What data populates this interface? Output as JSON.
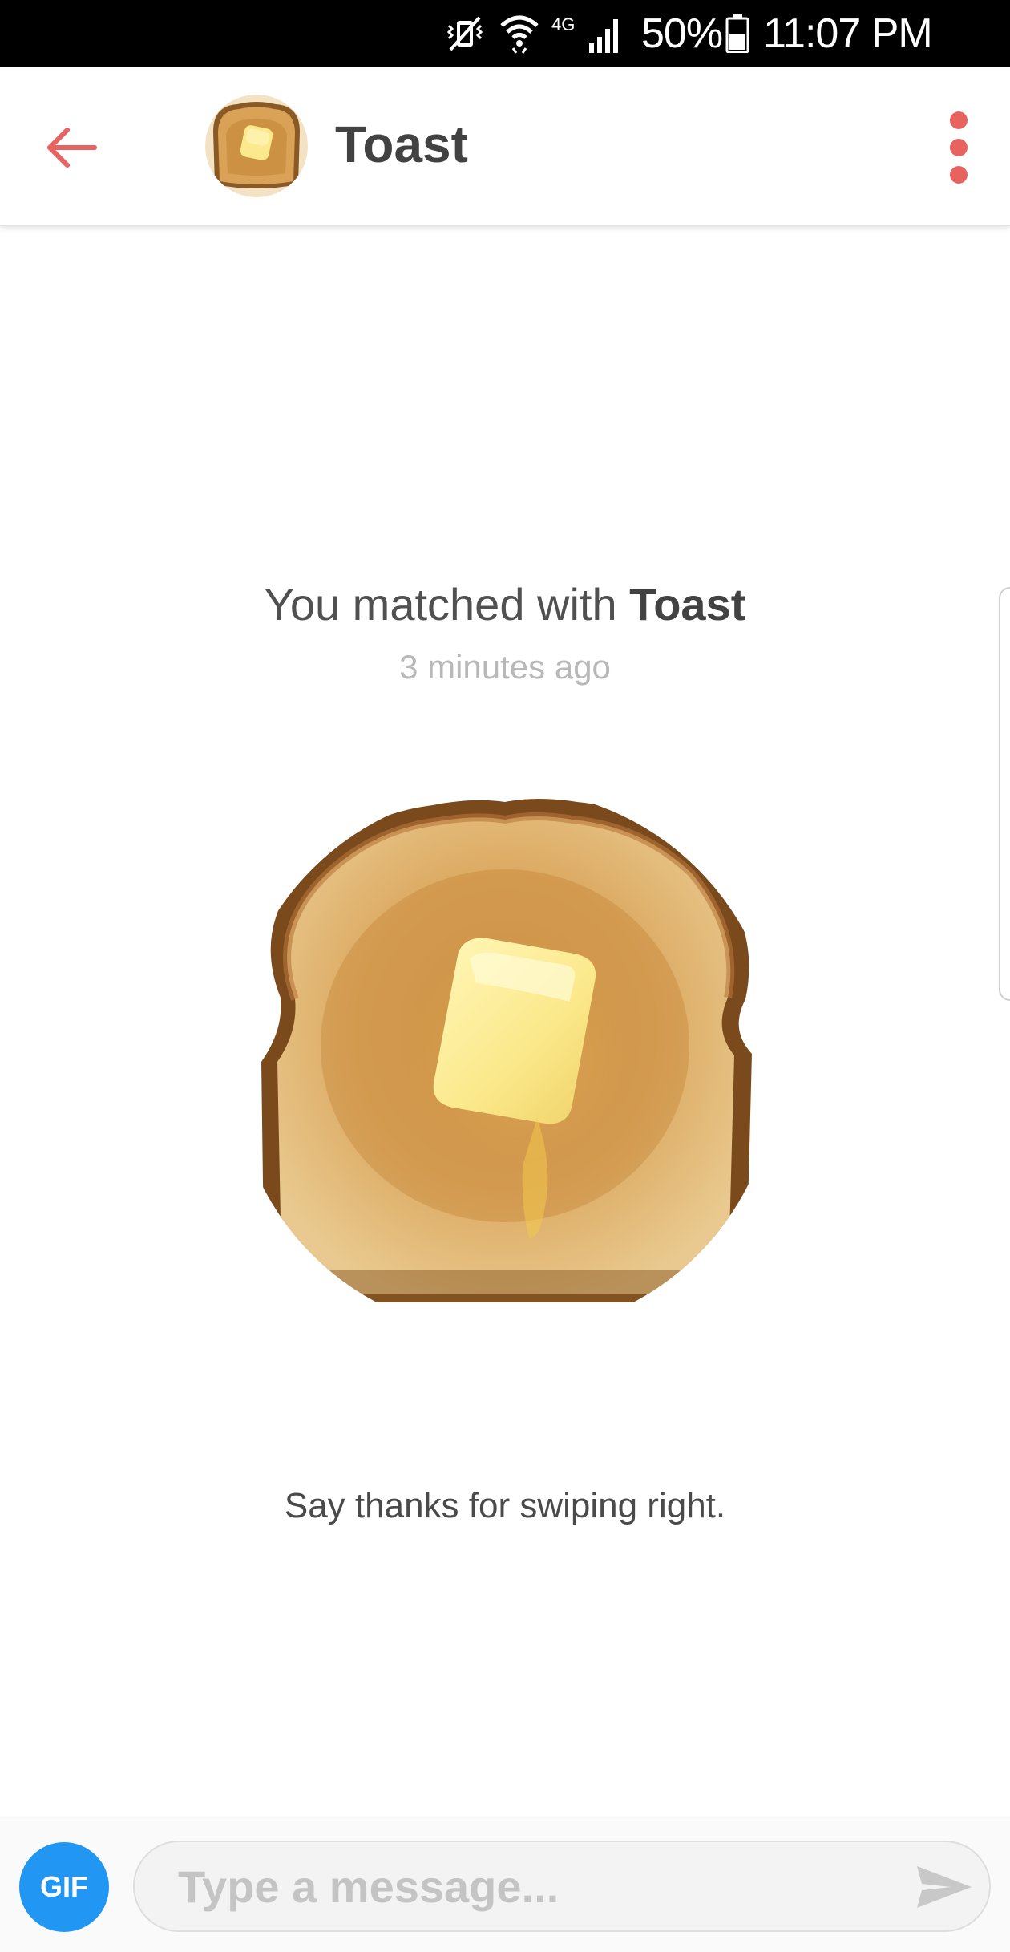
{
  "status_bar": {
    "battery_percent": "50%",
    "time": "11:07 PM",
    "network_label": "4G",
    "icons": [
      "vibrate-mute-icon",
      "wifi-icon",
      "signal-icon",
      "battery-icon"
    ]
  },
  "header": {
    "title": "Toast",
    "back_icon": "back-arrow-icon",
    "menu_icon": "more-vertical-icon",
    "accent_color": "#e8625f"
  },
  "match": {
    "prefix": "You matched with ",
    "name": "Toast",
    "time_ago": "3 minutes ago"
  },
  "prompt": "Say thanks for swiping right.",
  "composer": {
    "gif_label": "GIF",
    "placeholder": "Type a message...",
    "value": "",
    "gif_color": "#2196f3"
  }
}
